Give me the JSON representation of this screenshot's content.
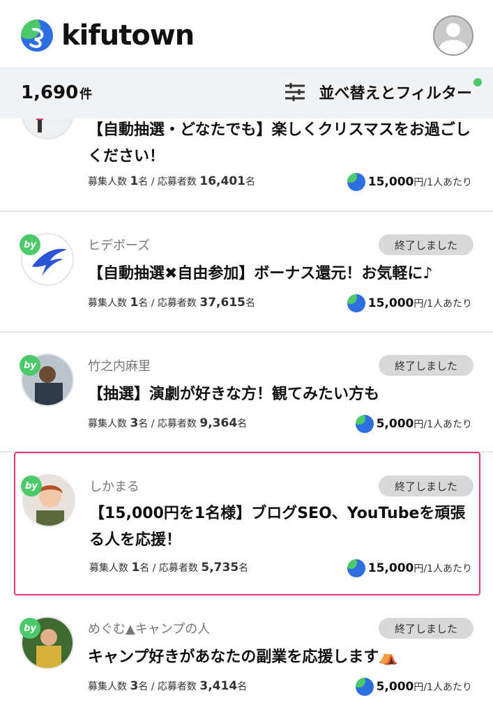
{
  "header": {
    "logo_text": "kifutown"
  },
  "filterbar": {
    "count": "1,690",
    "count_unit": "件",
    "filter_label": "並べ替えとフィルター"
  },
  "colors": {
    "brand_green": "#4cc96a",
    "brand_blue": "#2d6fe0",
    "highlight_border": "#e0386b",
    "pill_bg": "#d9d9d9"
  },
  "cards": [
    {
      "organizer": "",
      "status": "",
      "title": "【自動抽選・どなたでも】楽しくクリスマスをお過ごしください！",
      "recruit_label": "募集人数",
      "recruit_num": "1",
      "recruit_unit": "名",
      "sep": "/",
      "applicant_label": "応募者数",
      "applicant_num": "16,401",
      "applicant_unit": "名",
      "reward_amount": "15,000",
      "reward_unit": "円/1人あたり"
    },
    {
      "organizer": "ヒデボーズ",
      "status": "終了しました",
      "title": "【自動抽選✖自由参加】ボーナス還元！お気軽に♪",
      "recruit_label": "募集人数",
      "recruit_num": "1",
      "recruit_unit": "名",
      "sep": "/",
      "applicant_label": "応募者数",
      "applicant_num": "37,615",
      "applicant_unit": "名",
      "reward_amount": "15,000",
      "reward_unit": "円/1人あたり"
    },
    {
      "organizer": "竹之内麻里",
      "status": "終了しました",
      "title": "【抽選】演劇が好きな方！観てみたい方も",
      "recruit_label": "募集人数",
      "recruit_num": "3",
      "recruit_unit": "名",
      "sep": "/",
      "applicant_label": "応募者数",
      "applicant_num": "9,364",
      "applicant_unit": "名",
      "reward_amount": "5,000",
      "reward_unit": "円/1人あたり"
    },
    {
      "organizer": "しかまる",
      "status": "終了しました",
      "title": "【15,000円を1名様】ブログSEO、YouTubeを頑張る人を応援！",
      "recruit_label": "募集人数",
      "recruit_num": "1",
      "recruit_unit": "名",
      "sep": "/",
      "applicant_label": "応募者数",
      "applicant_num": "5,735",
      "applicant_unit": "名",
      "reward_amount": "15,000",
      "reward_unit": "円/1人あたり"
    },
    {
      "organizer": "めぐむ▲キャンプの人",
      "status": "終了しました",
      "title": "キャンプ好きがあなたの副業を応援します⛺",
      "recruit_label": "募集人数",
      "recruit_num": "3",
      "recruit_unit": "名",
      "sep": "/",
      "applicant_label": "応募者数",
      "applicant_num": "3,414",
      "applicant_unit": "名",
      "reward_amount": "5,000",
      "reward_unit": "円/1人あたり"
    }
  ],
  "by_badge": "by"
}
